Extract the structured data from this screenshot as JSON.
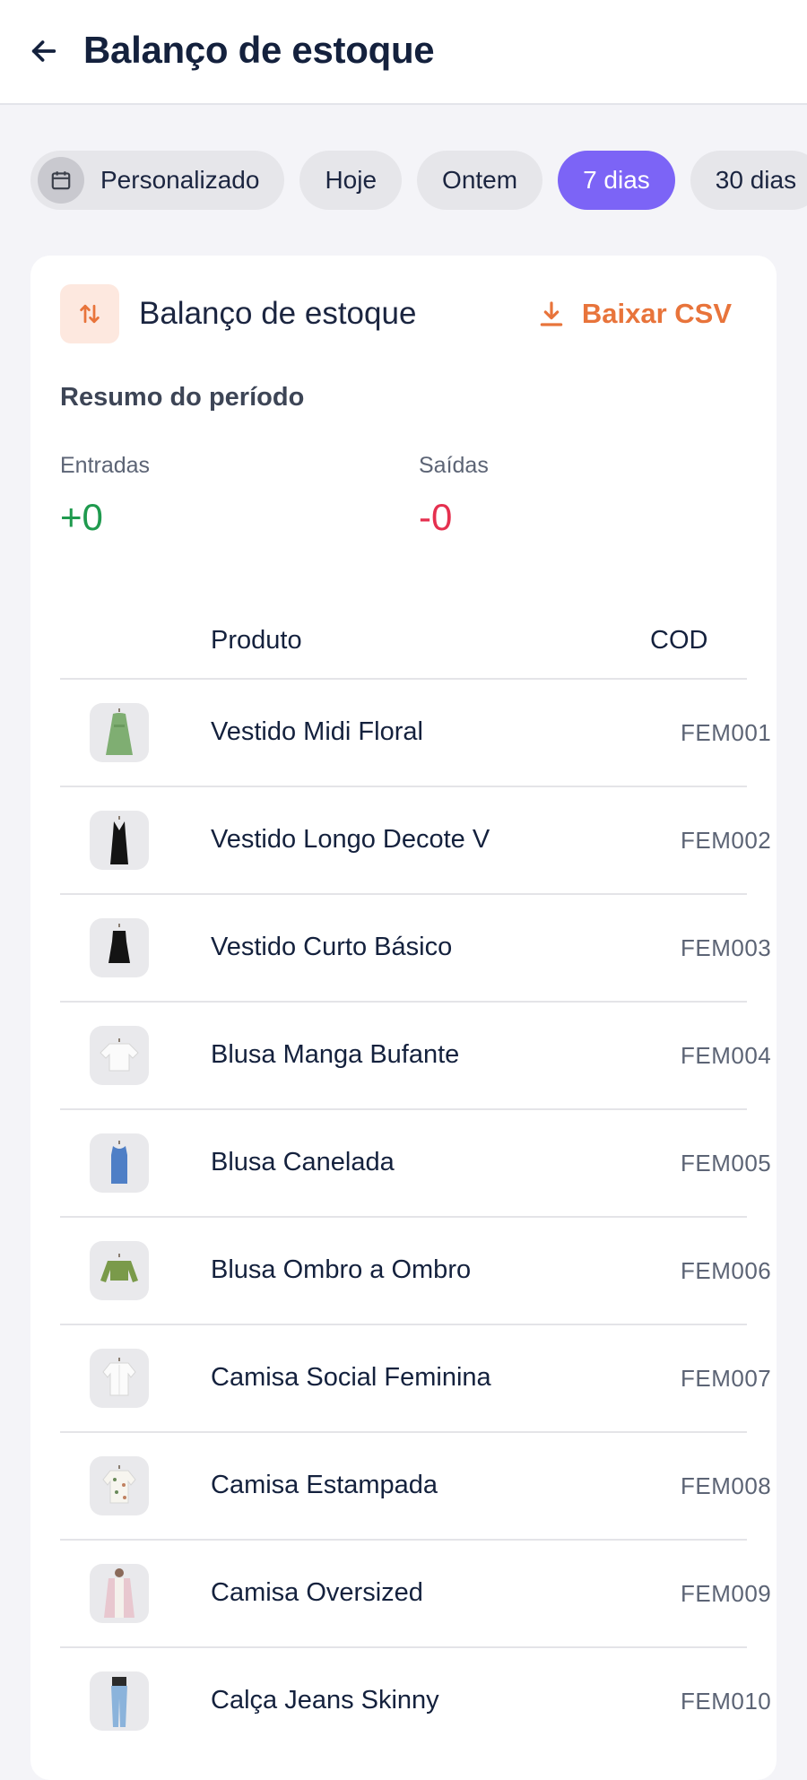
{
  "header": {
    "title": "Balanço de estoque"
  },
  "filters": {
    "chips": [
      "Personalizado",
      "Hoje",
      "Ontem",
      "7 dias",
      "30 dias"
    ],
    "active": "7 dias"
  },
  "card": {
    "title": "Balanço de estoque",
    "download_label": "Baixar CSV",
    "summary_title": "Resumo do período",
    "entradas_label": "Entradas",
    "entradas_value": "+0",
    "saidas_label": "Saídas",
    "saidas_value": "-0"
  },
  "table": {
    "headers": {
      "product": "Produto",
      "code": "COD"
    },
    "rows": [
      {
        "name": "Vestido Midi Floral",
        "code": "FEM001",
        "thumb": "green-dress-icon"
      },
      {
        "name": "Vestido Longo Decote V",
        "code": "FEM002",
        "thumb": "black-long-dress-icon"
      },
      {
        "name": "Vestido Curto Básico",
        "code": "FEM003",
        "thumb": "black-short-dress-icon"
      },
      {
        "name": "Blusa Manga Bufante",
        "code": "FEM004",
        "thumb": "white-blouse-icon"
      },
      {
        "name": "Blusa Canelada",
        "code": "FEM005",
        "thumb": "blue-tank-icon"
      },
      {
        "name": "Blusa Ombro a Ombro",
        "code": "FEM006",
        "thumb": "olive-crop-top-icon"
      },
      {
        "name": "Camisa Social Feminina",
        "code": "FEM007",
        "thumb": "white-shirt-icon"
      },
      {
        "name": "Camisa Estampada",
        "code": "FEM008",
        "thumb": "printed-shirt-icon"
      },
      {
        "name": "Camisa Oversized",
        "code": "FEM009",
        "thumb": "pink-shirt-icon"
      },
      {
        "name": "Calça Jeans Skinny",
        "code": "FEM010",
        "thumb": "jeans-icon"
      }
    ]
  },
  "colors": {
    "accent": "#7c64f6",
    "download": "#e8743b",
    "positive": "#1f9a4e",
    "negative": "#e5304f"
  }
}
